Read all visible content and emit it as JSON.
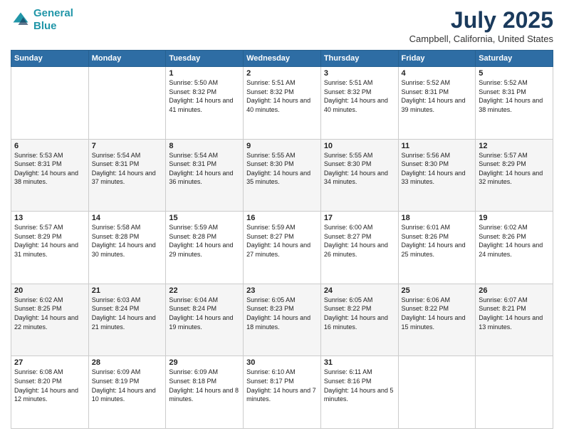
{
  "logo": {
    "line1": "General",
    "line2": "Blue"
  },
  "title": "July 2025",
  "subtitle": "Campbell, California, United States",
  "header_days": [
    "Sunday",
    "Monday",
    "Tuesday",
    "Wednesday",
    "Thursday",
    "Friday",
    "Saturday"
  ],
  "weeks": [
    [
      {
        "day": "",
        "sunrise": "",
        "sunset": "",
        "daylight": ""
      },
      {
        "day": "",
        "sunrise": "",
        "sunset": "",
        "daylight": ""
      },
      {
        "day": "1",
        "sunrise": "Sunrise: 5:50 AM",
        "sunset": "Sunset: 8:32 PM",
        "daylight": "Daylight: 14 hours and 41 minutes."
      },
      {
        "day": "2",
        "sunrise": "Sunrise: 5:51 AM",
        "sunset": "Sunset: 8:32 PM",
        "daylight": "Daylight: 14 hours and 40 minutes."
      },
      {
        "day": "3",
        "sunrise": "Sunrise: 5:51 AM",
        "sunset": "Sunset: 8:32 PM",
        "daylight": "Daylight: 14 hours and 40 minutes."
      },
      {
        "day": "4",
        "sunrise": "Sunrise: 5:52 AM",
        "sunset": "Sunset: 8:31 PM",
        "daylight": "Daylight: 14 hours and 39 minutes."
      },
      {
        "day": "5",
        "sunrise": "Sunrise: 5:52 AM",
        "sunset": "Sunset: 8:31 PM",
        "daylight": "Daylight: 14 hours and 38 minutes."
      }
    ],
    [
      {
        "day": "6",
        "sunrise": "Sunrise: 5:53 AM",
        "sunset": "Sunset: 8:31 PM",
        "daylight": "Daylight: 14 hours and 38 minutes."
      },
      {
        "day": "7",
        "sunrise": "Sunrise: 5:54 AM",
        "sunset": "Sunset: 8:31 PM",
        "daylight": "Daylight: 14 hours and 37 minutes."
      },
      {
        "day": "8",
        "sunrise": "Sunrise: 5:54 AM",
        "sunset": "Sunset: 8:31 PM",
        "daylight": "Daylight: 14 hours and 36 minutes."
      },
      {
        "day": "9",
        "sunrise": "Sunrise: 5:55 AM",
        "sunset": "Sunset: 8:30 PM",
        "daylight": "Daylight: 14 hours and 35 minutes."
      },
      {
        "day": "10",
        "sunrise": "Sunrise: 5:55 AM",
        "sunset": "Sunset: 8:30 PM",
        "daylight": "Daylight: 14 hours and 34 minutes."
      },
      {
        "day": "11",
        "sunrise": "Sunrise: 5:56 AM",
        "sunset": "Sunset: 8:30 PM",
        "daylight": "Daylight: 14 hours and 33 minutes."
      },
      {
        "day": "12",
        "sunrise": "Sunrise: 5:57 AM",
        "sunset": "Sunset: 8:29 PM",
        "daylight": "Daylight: 14 hours and 32 minutes."
      }
    ],
    [
      {
        "day": "13",
        "sunrise": "Sunrise: 5:57 AM",
        "sunset": "Sunset: 8:29 PM",
        "daylight": "Daylight: 14 hours and 31 minutes."
      },
      {
        "day": "14",
        "sunrise": "Sunrise: 5:58 AM",
        "sunset": "Sunset: 8:28 PM",
        "daylight": "Daylight: 14 hours and 30 minutes."
      },
      {
        "day": "15",
        "sunrise": "Sunrise: 5:59 AM",
        "sunset": "Sunset: 8:28 PM",
        "daylight": "Daylight: 14 hours and 29 minutes."
      },
      {
        "day": "16",
        "sunrise": "Sunrise: 5:59 AM",
        "sunset": "Sunset: 8:27 PM",
        "daylight": "Daylight: 14 hours and 27 minutes."
      },
      {
        "day": "17",
        "sunrise": "Sunrise: 6:00 AM",
        "sunset": "Sunset: 8:27 PM",
        "daylight": "Daylight: 14 hours and 26 minutes."
      },
      {
        "day": "18",
        "sunrise": "Sunrise: 6:01 AM",
        "sunset": "Sunset: 8:26 PM",
        "daylight": "Daylight: 14 hours and 25 minutes."
      },
      {
        "day": "19",
        "sunrise": "Sunrise: 6:02 AM",
        "sunset": "Sunset: 8:26 PM",
        "daylight": "Daylight: 14 hours and 24 minutes."
      }
    ],
    [
      {
        "day": "20",
        "sunrise": "Sunrise: 6:02 AM",
        "sunset": "Sunset: 8:25 PM",
        "daylight": "Daylight: 14 hours and 22 minutes."
      },
      {
        "day": "21",
        "sunrise": "Sunrise: 6:03 AM",
        "sunset": "Sunset: 8:24 PM",
        "daylight": "Daylight: 14 hours and 21 minutes."
      },
      {
        "day": "22",
        "sunrise": "Sunrise: 6:04 AM",
        "sunset": "Sunset: 8:24 PM",
        "daylight": "Daylight: 14 hours and 19 minutes."
      },
      {
        "day": "23",
        "sunrise": "Sunrise: 6:05 AM",
        "sunset": "Sunset: 8:23 PM",
        "daylight": "Daylight: 14 hours and 18 minutes."
      },
      {
        "day": "24",
        "sunrise": "Sunrise: 6:05 AM",
        "sunset": "Sunset: 8:22 PM",
        "daylight": "Daylight: 14 hours and 16 minutes."
      },
      {
        "day": "25",
        "sunrise": "Sunrise: 6:06 AM",
        "sunset": "Sunset: 8:22 PM",
        "daylight": "Daylight: 14 hours and 15 minutes."
      },
      {
        "day": "26",
        "sunrise": "Sunrise: 6:07 AM",
        "sunset": "Sunset: 8:21 PM",
        "daylight": "Daylight: 14 hours and 13 minutes."
      }
    ],
    [
      {
        "day": "27",
        "sunrise": "Sunrise: 6:08 AM",
        "sunset": "Sunset: 8:20 PM",
        "daylight": "Daylight: 14 hours and 12 minutes."
      },
      {
        "day": "28",
        "sunrise": "Sunrise: 6:09 AM",
        "sunset": "Sunset: 8:19 PM",
        "daylight": "Daylight: 14 hours and 10 minutes."
      },
      {
        "day": "29",
        "sunrise": "Sunrise: 6:09 AM",
        "sunset": "Sunset: 8:18 PM",
        "daylight": "Daylight: 14 hours and 8 minutes."
      },
      {
        "day": "30",
        "sunrise": "Sunrise: 6:10 AM",
        "sunset": "Sunset: 8:17 PM",
        "daylight": "Daylight: 14 hours and 7 minutes."
      },
      {
        "day": "31",
        "sunrise": "Sunrise: 6:11 AM",
        "sunset": "Sunset: 8:16 PM",
        "daylight": "Daylight: 14 hours and 5 minutes."
      },
      {
        "day": "",
        "sunrise": "",
        "sunset": "",
        "daylight": ""
      },
      {
        "day": "",
        "sunrise": "",
        "sunset": "",
        "daylight": ""
      }
    ]
  ]
}
